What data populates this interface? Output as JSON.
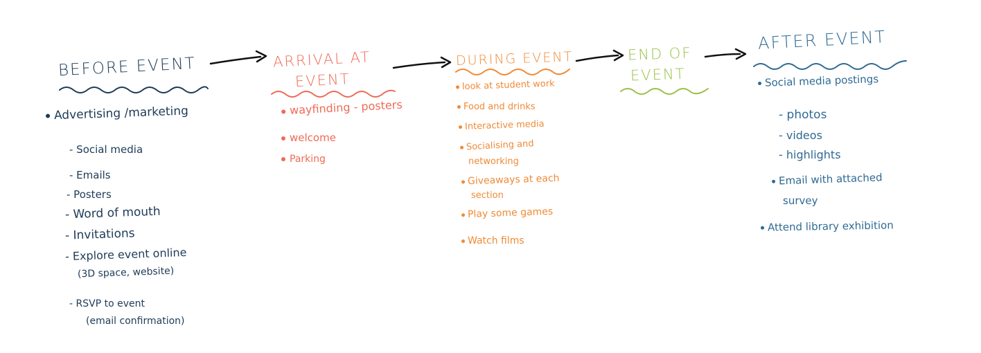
{
  "colors": {
    "before": "#1d3b57",
    "arrival": "#ef6a55",
    "during": "#f08a35",
    "end": "#9ac14a",
    "after": "#2f6a93",
    "arrow": "#111111"
  },
  "stages": {
    "before": {
      "title": "BEFORE EVENT",
      "bullet": "Advertising /marketing",
      "subitems": [
        "- Social media",
        "- Emails",
        "- Posters",
        "- Word of mouth",
        "- Invitations",
        "- Explore event online",
        "(3D space, website)",
        "- RSVP to event",
        "(email confirmation)"
      ]
    },
    "arrival": {
      "title_line1": "ARRIVAL AT",
      "title_line2": "EVENT",
      "items": [
        "wayfinding - posters",
        "welcome",
        "Parking"
      ]
    },
    "during": {
      "title": "DURING EVENT",
      "items": [
        "look at student work",
        "Food and drinks",
        "Interactive media",
        "Socialising and",
        "networking",
        "Giveaways at each",
        "section",
        "Play some games",
        "Watch films"
      ]
    },
    "end": {
      "title_line1": "END OF",
      "title_line2": "EVENT"
    },
    "after": {
      "title": "AFTER EVENT",
      "items": [
        "Social media postings",
        "- photos",
        "- videos",
        "- highlights",
        "Email with attached",
        "survey",
        "Attend library exhibition"
      ]
    }
  }
}
